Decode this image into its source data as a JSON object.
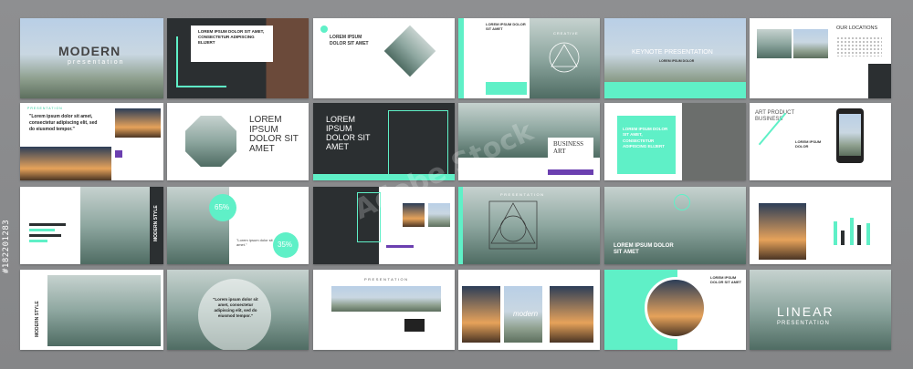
{
  "slides": {
    "modern": {
      "title": "MODERN",
      "subtitle": "presentation"
    },
    "lorem_dark_1": {
      "title": "LOREM IPSUM DOLOR SIT AMET, CONSECTETUR ADIPISCING ELIJERT"
    },
    "lorem_circle": {
      "title": "LOREM IPSUM DOLOR SIT AMET"
    },
    "creative": {
      "label": "CREATIVE",
      "heading": "LOREM IPSUM DOLOR SIT AMET"
    },
    "keynote": {
      "title": "KEYNOTE PRESENTATION",
      "subtitle": "LOREM IPSUM DOLOR"
    },
    "locations": {
      "title": "OUR LOCATIONS"
    },
    "quote_1": {
      "label": "PRESENTATION",
      "quote": "\"Lorem ipsum dolor sit amet, consectetur adipiscing elit, sed do eiusmod tempor.\""
    },
    "lorem_octagon": {
      "title": "LOREM IPSUM DOLOR SIT AMET"
    },
    "lorem_dark_2": {
      "title": "LOREM IPSUM DOLOR SIT AMET"
    },
    "business_art": {
      "title": "BUSINESS ART"
    },
    "lorem_mint": {
      "title": "LOREM IPSUM DOLOR SIT AMET, CONSECTETUR ADIPISCING ELIJERT"
    },
    "art_product": {
      "title": "ART PRODUCT BUSINESS",
      "side": "LOREM IPSUM DOLOR"
    },
    "modern_style_1": {
      "vertical": "MODERN STYLE"
    },
    "percent": {
      "value1": "65%",
      "value2": "35%",
      "quote": "\"Lorem ipsum dolor sit amet.\""
    },
    "presentation_geo": {
      "label": "PRESENTATION"
    },
    "lorem_fog": {
      "title": "LOREM IPSUM DOLOR SIT AMET"
    },
    "modern_style_2": {
      "vertical": "MODERN STYLE"
    },
    "quote_circle": {
      "quote": "\"Lorem ipsum dolor sit amet, consectetur adipiscing elit, sed do eiusmod tempor.\""
    },
    "presentation_wide": {
      "label": "PRESENTATION"
    },
    "modern_photo": {
      "word": "modern"
    },
    "lorem_round": {
      "title": "LOREM IPSUM DOLOR SIT AMET"
    },
    "linear": {
      "title": "LINEAR",
      "subtitle": "PRESENTATION"
    }
  },
  "watermark": {
    "text": "Adobe Stock",
    "id": "#182201283"
  },
  "colors": {
    "mint": "#5ff0c7",
    "dark": "#2b2f31",
    "purple": "#6b3fb0",
    "background": "#8b8c8e"
  },
  "chart_bars": [
    {
      "name": "bar-a",
      "value": 0.8
    },
    {
      "name": "bar-b",
      "value": 0.55
    },
    {
      "name": "bar-c",
      "value": 0.7
    },
    {
      "name": "bar-d",
      "value": 0.4
    }
  ]
}
